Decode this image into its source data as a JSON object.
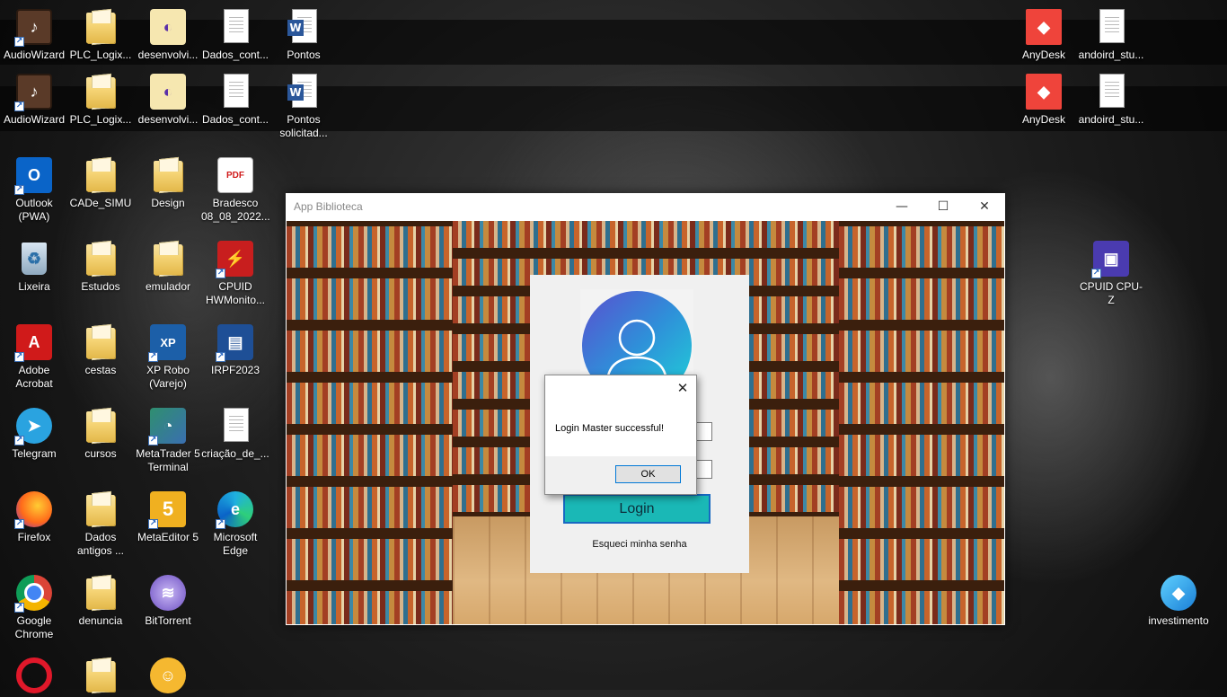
{
  "desktop": {
    "icons": [
      {
        "label": "AudioWizard"
      },
      {
        "label": "PLC_Logix..."
      },
      {
        "label": "desenvolvi..."
      },
      {
        "label": "Dados_cont..."
      },
      {
        "label": "Pontos"
      },
      {
        "label": "AudioWizard"
      },
      {
        "label": "PLC_Logix..."
      },
      {
        "label": "desenvolvi..."
      },
      {
        "label": "Dados_cont..."
      },
      {
        "label": "Pontos solicitad..."
      },
      {
        "label": "Outlook (PWA)"
      },
      {
        "label": "CADe_SIMU"
      },
      {
        "label": "Design"
      },
      {
        "label": "Bradesco 08_08_2022..."
      },
      {
        "label": "Lixeira"
      },
      {
        "label": "Estudos"
      },
      {
        "label": "emulador"
      },
      {
        "label": "CPUID HWMonito..."
      },
      {
        "label": "Adobe Acrobat"
      },
      {
        "label": "cestas"
      },
      {
        "label": "XP Robo (Varejo)"
      },
      {
        "label": "IRPF2023"
      },
      {
        "label": "Telegram"
      },
      {
        "label": "cursos"
      },
      {
        "label": "MetaTrader 5 Terminal"
      },
      {
        "label": "criação_de_..."
      },
      {
        "label": "Firefox"
      },
      {
        "label": "Dados antigos ..."
      },
      {
        "label": "MetaEditor 5"
      },
      {
        "label": "Microsoft Edge"
      },
      {
        "label": "Google Chrome"
      },
      {
        "label": "denuncia"
      },
      {
        "label": "BitTorrent"
      },
      {
        "label": "AnyDesk"
      },
      {
        "label": "andoird_stu..."
      },
      {
        "label": "AnyDesk"
      },
      {
        "label": "andoird_stu..."
      },
      {
        "label": "CPUID CPU-Z"
      },
      {
        "label": "investimento"
      }
    ],
    "glyphs": {
      "pdf": "PDF",
      "xp": "XP",
      "metaeditor": "5"
    }
  },
  "app": {
    "title": "App Biblioteca",
    "minimize": "—",
    "maximize": "☐",
    "close": "✕",
    "login_button": "Login",
    "forgot_password": "Esqueci minha senha",
    "accent_color": "#1ab8b6"
  },
  "message_box": {
    "text": "Login Master successful!",
    "ok_label": "OK",
    "close": "✕"
  }
}
